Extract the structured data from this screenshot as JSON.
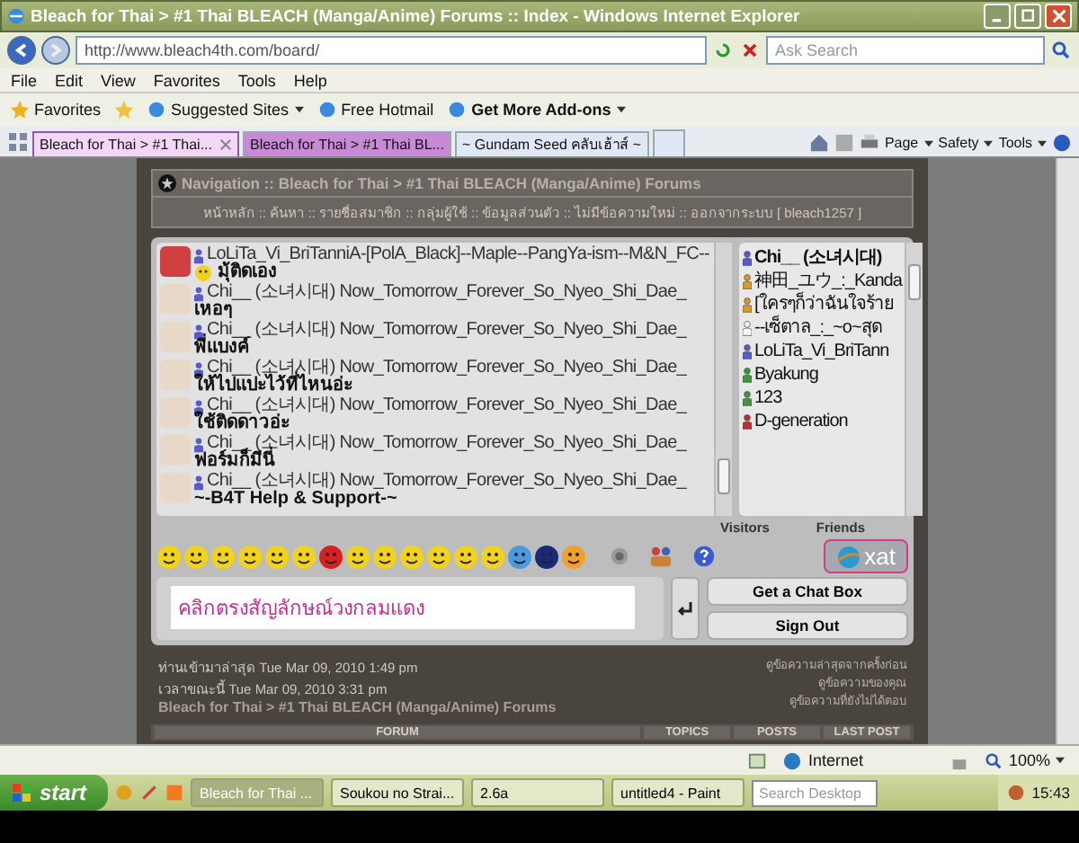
{
  "window": {
    "title": "Bleach for Thai > #1 Thai BLEACH (Manga/Anime) Forums :: Index - Windows Internet Explorer"
  },
  "address_bar": {
    "url": "http://www.bleach4th.com/board/",
    "search_placeholder": "Ask Search"
  },
  "menu": [
    "File",
    "Edit",
    "View",
    "Favorites",
    "Tools",
    "Help"
  ],
  "favorites_bar": {
    "favorites": "Favorites",
    "items": [
      {
        "label": "Suggested Sites",
        "dropdown": true
      },
      {
        "label": "Free Hotmail",
        "dropdown": false
      },
      {
        "label": "Get More Add-ons",
        "dropdown": true
      }
    ]
  },
  "tabs": [
    {
      "label": "Bleach for Thai > #1 Thai...",
      "selected": true,
      "closable": true
    },
    {
      "label": "Bleach for Thai > #1 Thai BL...",
      "selected": false,
      "closable": false
    },
    {
      "label": "~ Gundam Seed คลับเฮ้าส์ ~",
      "selected": false,
      "closable": false
    }
  ],
  "command_bar": [
    "Page",
    "Safety",
    "Tools"
  ],
  "navigation": {
    "title": "Navigation :: Bleach for Thai > #1 Thai BLEACH (Manga/Anime) Forums",
    "links": "หน้าหลัก :: ค้นหา :: รายชื่อสมาชิก :: กลุ่มผู้ใช้ :: ข้อมูลส่วนตัว :: ไม่มีข้อความใหม่ :: ออกจากระบบ [ bleach1257 ]"
  },
  "chat": {
    "messages": [
      {
        "user": "LoLiTa_Vi_BriTanniA-[PolA_Black]--Maple--PangYa-ism--M&N_FC--",
        "text": "มุ้ติดเอง",
        "emoticon": true
      },
      {
        "user": "Chi__ (소녀시대) Now_Tomorrow_Forever_So_Nyeo_Shi_Dae_",
        "text": "เหอๆ",
        "emoticon": false
      },
      {
        "user": "Chi__ (소녀시대) Now_Tomorrow_Forever_So_Nyeo_Shi_Dae_",
        "text": "พี่แบงค์",
        "emoticon": false
      },
      {
        "user": "Chi__ (소녀시대) Now_Tomorrow_Forever_So_Nyeo_Shi_Dae_",
        "text": "ให้ไปแปะไว้ที่ไหนอ่ะ",
        "emoticon": false
      },
      {
        "user": "Chi__ (소녀시대) Now_Tomorrow_Forever_So_Nyeo_Shi_Dae_",
        "text": "ใช้ติดดาวอ่ะ",
        "emoticon": false
      },
      {
        "user": "Chi__ (소녀시대) Now_Tomorrow_Forever_So_Nyeo_Shi_Dae_",
        "text": "ฟอร์มก็มีนี่",
        "emoticon": false
      },
      {
        "user": "Chi__ (소녀시대) Now_Tomorrow_Forever_So_Nyeo_Shi_Dae_",
        "text": "~-B4T Help & Support-~",
        "emoticon": false
      }
    ],
    "users": [
      {
        "name": "Chi__ (소녀시대)",
        "color": "#5a5acc",
        "bold": true
      },
      {
        "name": "神田_ユウ_:_Kanda",
        "color": "#d89a2a",
        "bold": false
      },
      {
        "name": "[ใครๆก็ว่าฉันใจร้าย",
        "color": "#d89a2a",
        "bold": false
      },
      {
        "name": "--เซ็ตาล_:_~o~สุด",
        "color": "#f4f4f4",
        "bold": false
      },
      {
        "name": "LoLiTa_Vi_BriTann",
        "color": "#5a5acc",
        "bold": false
      },
      {
        "name": "Byakung",
        "color": "#3a9a3a",
        "bold": false
      },
      {
        "name": "123",
        "color": "#3a9a3a",
        "bold": false
      },
      {
        "name": "D-generation",
        "color": "#c03030",
        "bold": false
      }
    ],
    "user_tabs": [
      "Visitors",
      "Friends"
    ],
    "input_value": "คลิกตรงสัญลักษณ์วงกลมแดง",
    "buttons": [
      "Get a Chat Box",
      "Sign Out"
    ],
    "logo": "xat"
  },
  "info": {
    "last_visit": "ท่านเข้ามาล่าสุด Tue Mar 09, 2010 1:49 pm",
    "current_time": "เวลาขณะนี้ Tue Mar 09, 2010 3:31 pm",
    "forum_title": "Bleach for Thai > #1 Thai BLEACH (Manga/Anime) Forums",
    "links": [
      "ดูข้อความล่าสุดจากครั้งก่อน",
      "ดูข้อความของคุณ",
      "ดูข้อความที่ยังไม่ได้ตอบ"
    ]
  },
  "table": {
    "columns": [
      "FORUM",
      "TOPICS",
      "POSTS",
      "LAST POST"
    ]
  },
  "status_bar": {
    "zone": "Internet",
    "zoom": "100%"
  },
  "taskbar": {
    "start": "start",
    "tasks": [
      {
        "label": "Bleach for Thai ...",
        "selected": true
      },
      {
        "label": "Soukou no Strai...",
        "selected": false
      },
      {
        "label": "2.6a",
        "selected": false
      },
      {
        "label": "untitled4 - Paint",
        "selected": false
      }
    ],
    "search_placeholder": "Search Desktop",
    "clock": "15:43"
  }
}
